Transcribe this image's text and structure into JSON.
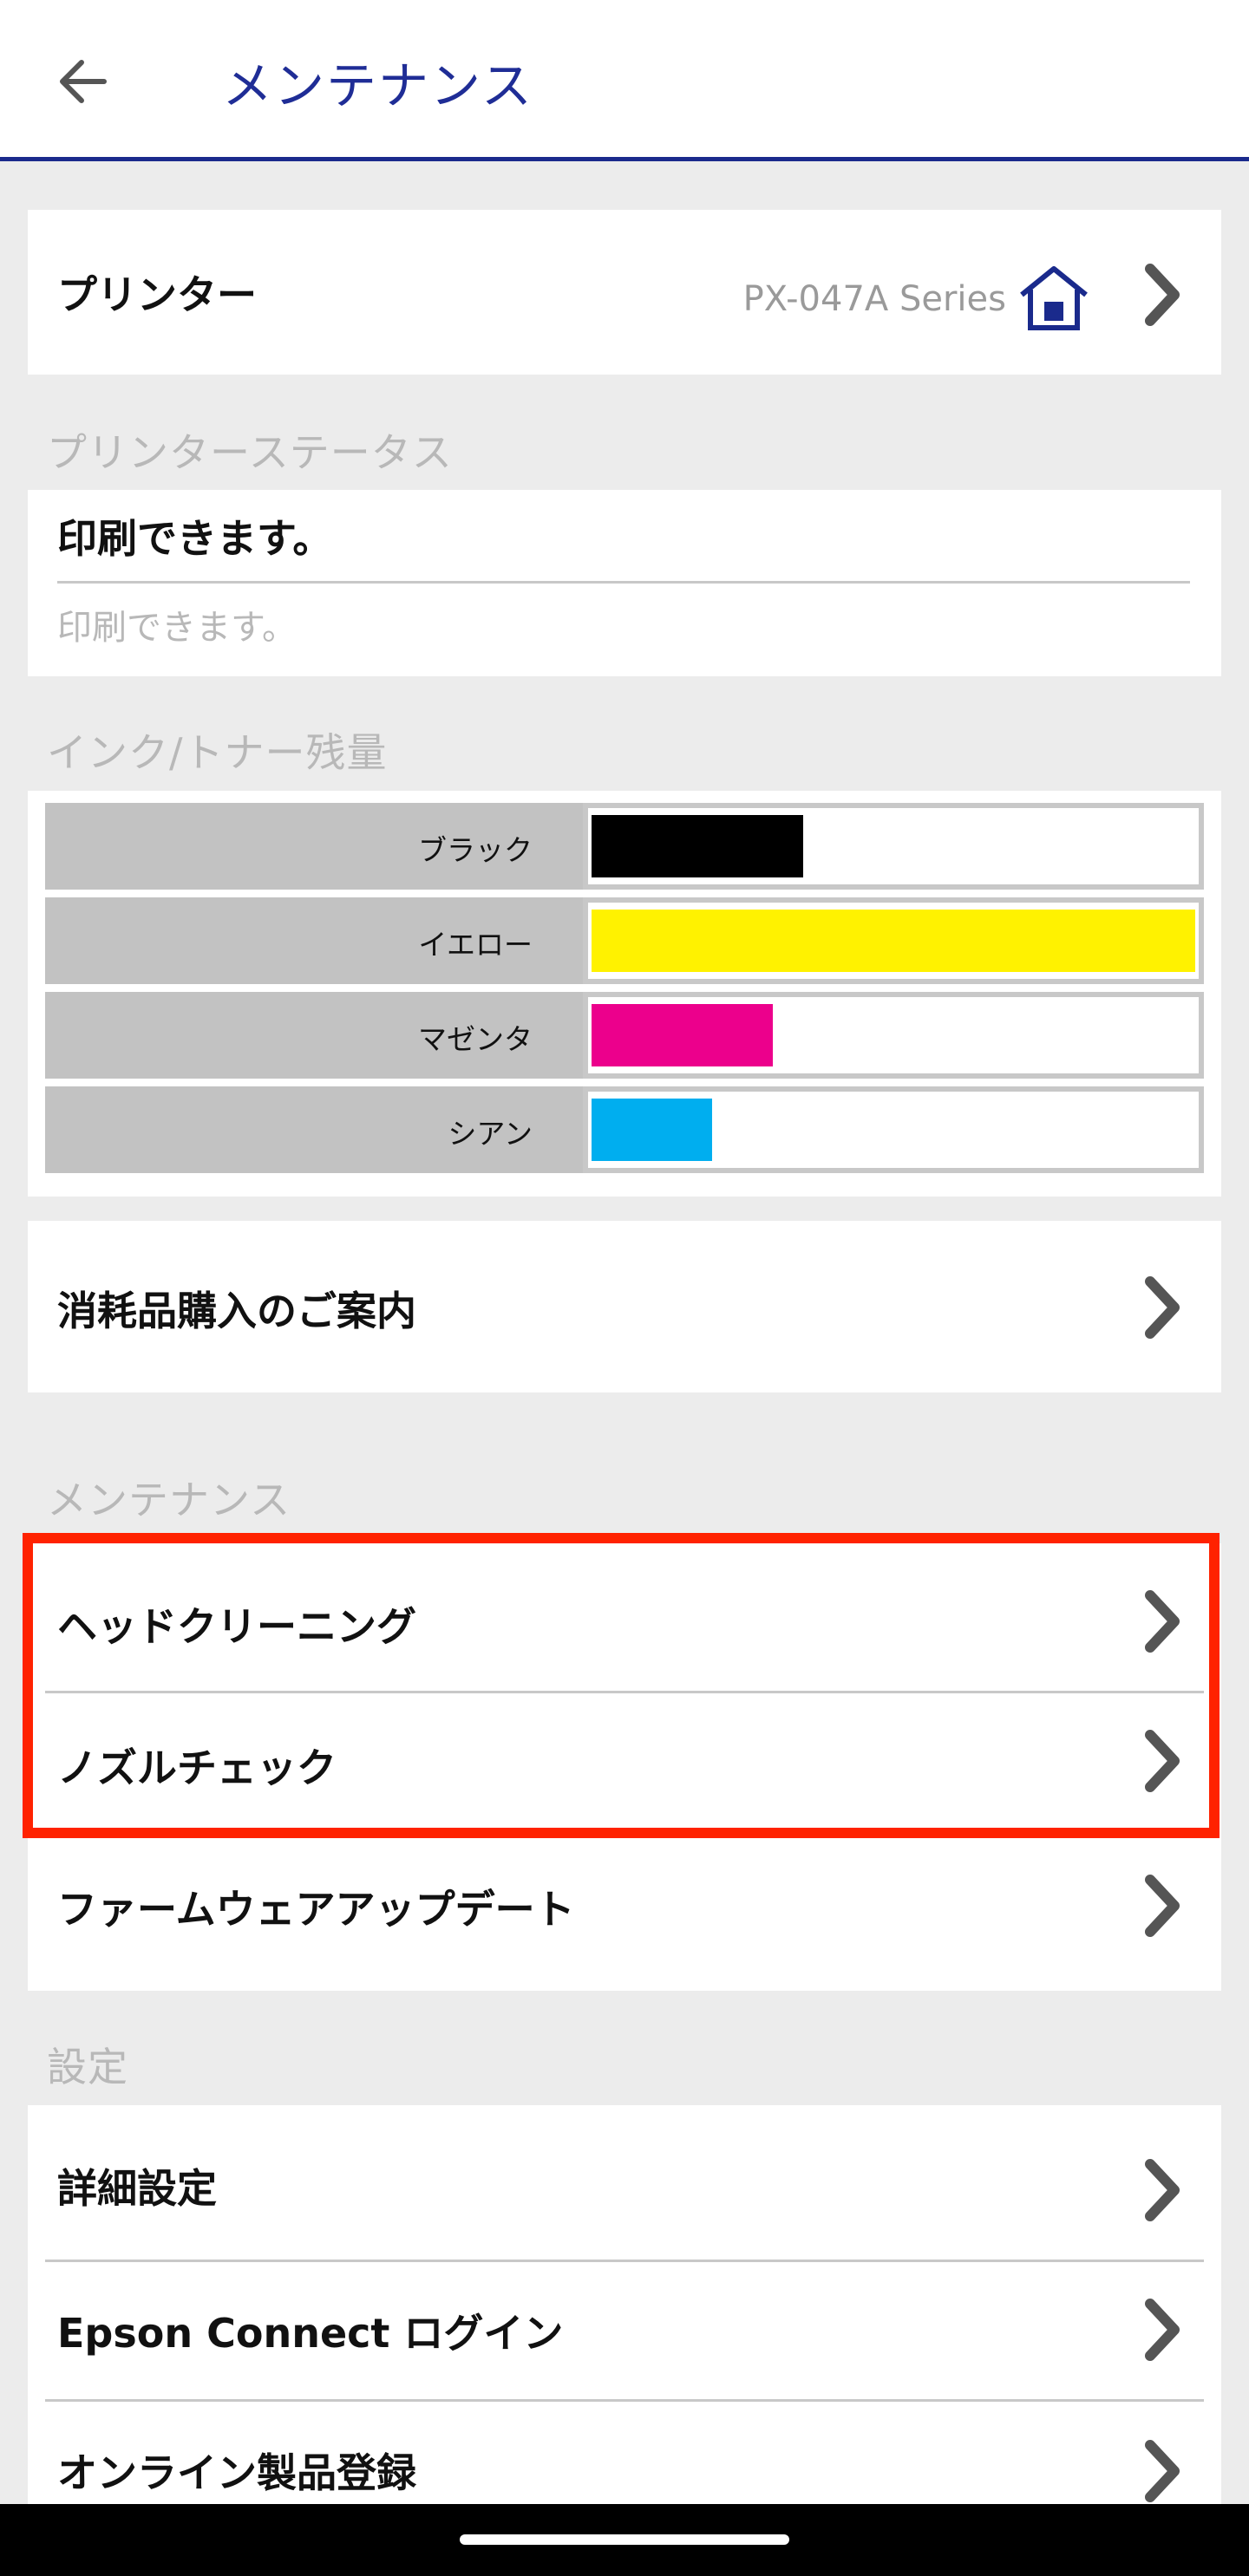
{
  "appbar": {
    "title": "メンテナンス",
    "back_icon": "arrow-left-icon"
  },
  "printer": {
    "label": "プリンター",
    "model": "PX-047A Series"
  },
  "status_section": {
    "label": "プリンターステータス",
    "main": "印刷できます。",
    "sub": "印刷できます。"
  },
  "ink_section": {
    "label": "インク/トナー残量",
    "inks": [
      {
        "name": "ブラック",
        "level": 0.35,
        "color": "#000000"
      },
      {
        "name": "イエロー",
        "level": 1.0,
        "color": "#fff200"
      },
      {
        "name": "マゼンタ",
        "level": 0.3,
        "color": "#ec008c"
      },
      {
        "name": "シアン",
        "level": 0.2,
        "color": "#00aeef"
      }
    ]
  },
  "supplies": {
    "label": "消耗品購入のご案内"
  },
  "maintenance_section": {
    "label": "メンテナンス",
    "items": [
      "ヘッドクリーニング",
      "ノズルチェック",
      "ファームウェアアップデート"
    ]
  },
  "settings_section": {
    "label": "設定",
    "items": [
      "詳細設定",
      "Epson Connect ログイン",
      "オンライン製品登録"
    ]
  },
  "colors": {
    "accent": "#1f2d96",
    "highlight": "#ff2200"
  }
}
